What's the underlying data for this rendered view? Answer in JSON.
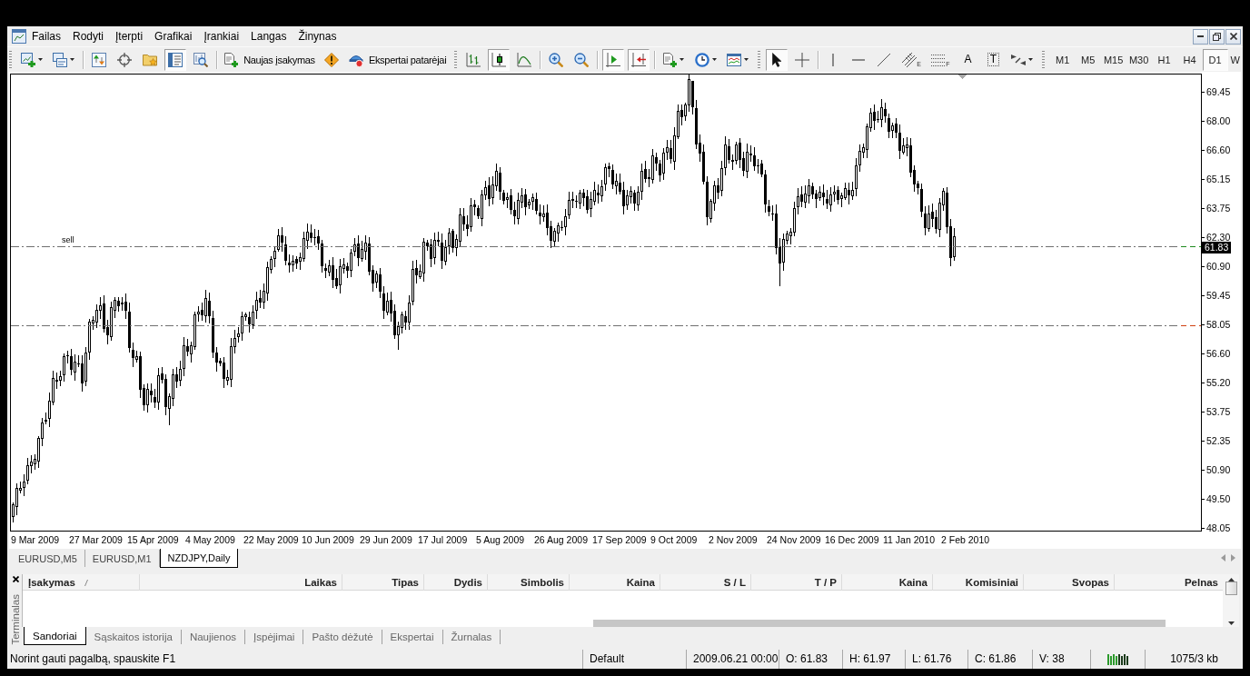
{
  "menu": {
    "items": [
      "Failas",
      "Rodyti",
      "Įterpti",
      "Grafikai",
      "Įrankiai",
      "Langas",
      "Žinynas"
    ]
  },
  "toolbar": {
    "items": [
      {
        "kind": "grip"
      },
      {
        "kind": "icon",
        "pressed": false,
        "dropdown": true
      },
      {
        "kind": "icon",
        "pressed": false,
        "dropdown": true
      },
      {
        "kind": "separator"
      },
      {
        "kind": "icon",
        "pressed": false
      },
      {
        "kind": "icon",
        "pressed": false
      },
      {
        "kind": "icon",
        "pressed": false
      },
      {
        "kind": "icon",
        "pressed": true
      },
      {
        "kind": "icon",
        "pressed": false
      },
      {
        "kind": "separator"
      },
      {
        "kind": "text",
        "label": "Naujas įsakymas"
      },
      {
        "kind": "icon",
        "pressed": false
      },
      {
        "kind": "text",
        "label": "Ekspertai patarėjai"
      },
      {
        "kind": "grip"
      },
      {
        "kind": "icon",
        "pressed": false
      },
      {
        "kind": "icon",
        "pressed": true
      },
      {
        "kind": "icon",
        "pressed": false
      },
      {
        "kind": "separator"
      },
      {
        "kind": "icon",
        "pressed": false
      },
      {
        "kind": "icon",
        "pressed": false
      },
      {
        "kind": "separator"
      },
      {
        "kind": "icon",
        "pressed": true
      },
      {
        "kind": "icon",
        "pressed": true
      },
      {
        "kind": "separator"
      },
      {
        "kind": "icon",
        "pressed": false,
        "dropdown": true
      },
      {
        "kind": "icon",
        "pressed": false,
        "dropdown": true
      },
      {
        "kind": "icon",
        "pressed": false,
        "dropdown": true
      },
      {
        "kind": "grip"
      },
      {
        "kind": "icon",
        "pressed": true
      },
      {
        "kind": "icon",
        "pressed": false
      },
      {
        "kind": "separator"
      },
      {
        "kind": "icon",
        "pressed": false
      },
      {
        "kind": "icon",
        "pressed": false
      },
      {
        "kind": "icon",
        "pressed": false
      },
      {
        "kind": "icon",
        "pressed": false,
        "subscript": "E"
      },
      {
        "kind": "icon",
        "pressed": false,
        "subscript": "F"
      },
      {
        "kind": "glyph",
        "label": "A",
        "framed": false
      },
      {
        "kind": "glyph",
        "label": "T",
        "framed": true
      },
      {
        "kind": "icon",
        "pressed": false,
        "dropdown": true
      },
      {
        "kind": "grip"
      }
    ],
    "timeframes": [
      {
        "label": "M1",
        "selected": false
      },
      {
        "label": "M5",
        "selected": false
      },
      {
        "label": "M15",
        "selected": false
      },
      {
        "label": "M30",
        "selected": false
      },
      {
        "label": "H1",
        "selected": false
      },
      {
        "label": "H4",
        "selected": false
      },
      {
        "label": "D1",
        "selected": true
      },
      {
        "label": "W",
        "selected": false
      }
    ]
  },
  "chart": {
    "order_label": "sell",
    "price_ticks": [
      "69.45",
      "68.00",
      "66.60",
      "65.15",
      "63.75",
      "62.30",
      "60.90",
      "59.45",
      "58.05",
      "56.60",
      "55.20",
      "53.75",
      "52.35",
      "50.90",
      "49.50",
      "48.05"
    ],
    "current_price": "61.83",
    "dates": [
      "9 Mar 2009",
      "27 Mar 2009",
      "15 Apr 2009",
      "4 May 2009",
      "22 May 2009",
      "10 Jun 2009",
      "29 Jun 2009",
      "17 Jul 2009",
      "5 Aug 2009",
      "26 Aug 2009",
      "17 Sep 2009",
      "9 Oct 2009",
      "2 Nov 2009",
      "24 Nov 2009",
      "16 Dec 2009",
      "11 Jan 2010",
      "2 Feb 2010"
    ]
  },
  "chart_tabs": [
    {
      "label": "EURUSD,M5",
      "selected": false
    },
    {
      "label": "EURUSD,M1",
      "selected": false
    },
    {
      "label": "NZDJPY,Daily",
      "selected": true
    }
  ],
  "terminal": {
    "title": "Terminalas",
    "columns": [
      {
        "label": "Įsakymas",
        "sorted": true
      },
      {
        "label": "Laikas",
        "sorted": false
      },
      {
        "label": "Tipas",
        "sorted": false
      },
      {
        "label": "Dydis",
        "sorted": false
      },
      {
        "label": "Simbolis",
        "sorted": false
      },
      {
        "label": "Kaina",
        "sorted": false
      },
      {
        "label": "S / L",
        "sorted": false
      },
      {
        "label": "T / P",
        "sorted": false
      },
      {
        "label": "Kaina",
        "sorted": false
      },
      {
        "label": "Komisiniai",
        "sorted": false
      },
      {
        "label": "Svopas",
        "sorted": false
      },
      {
        "label": "Pelnas",
        "sorted": false
      }
    ],
    "tabs": [
      {
        "label": "Sandoriai",
        "selected": true
      },
      {
        "label": "Sąskaitos istorija",
        "selected": false
      },
      {
        "label": "Naujienos",
        "selected": false
      },
      {
        "label": "Įspėjimai",
        "selected": false
      },
      {
        "label": "Pašto dėžutė",
        "selected": false
      },
      {
        "label": "Ekspertai",
        "selected": false
      },
      {
        "label": "Žurnalas",
        "selected": false
      }
    ]
  },
  "status_bar": {
    "message": "Norint gauti pagalbą, spauskite F1",
    "profile": "Default",
    "time": "2009.06.21 00:00",
    "open": "O: 61.83",
    "high": "H: 61.97",
    "low": "L: 61.76",
    "close": "C: 61.86",
    "volume": "V: 38",
    "traffic": "1075/3 kb"
  }
}
